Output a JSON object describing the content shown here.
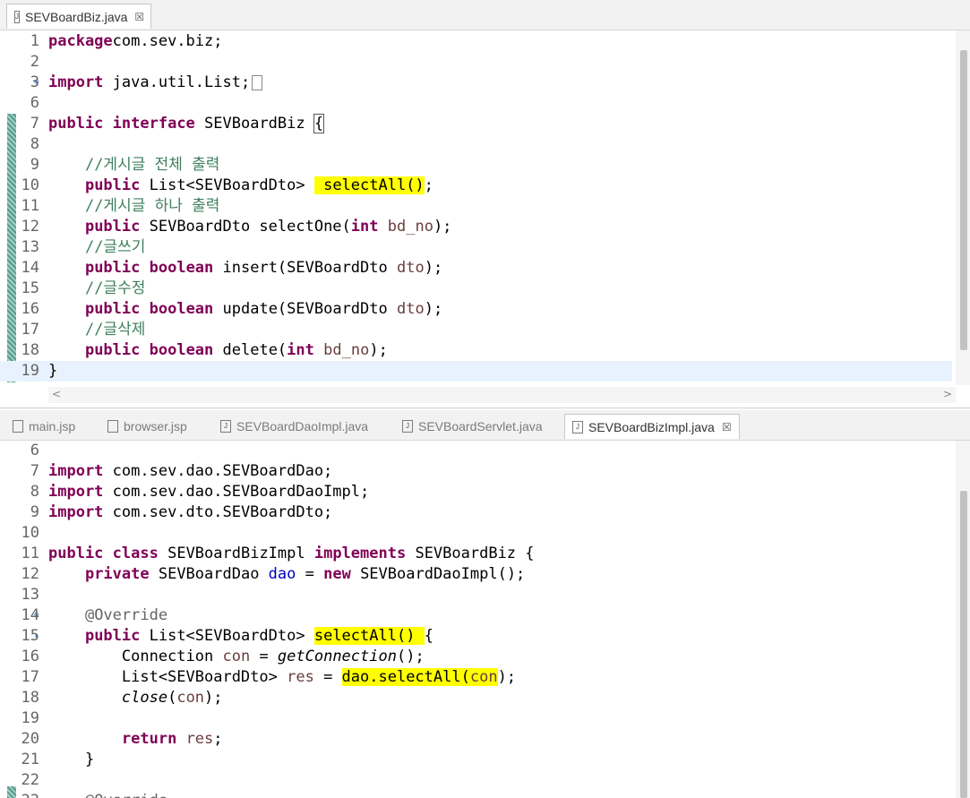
{
  "top_editor": {
    "tab": {
      "label": "SEVBoardBiz.java",
      "close": "☒"
    },
    "lines": [
      {
        "n": "1",
        "mark": "",
        "t": [
          [
            "kw",
            "package"
          ],
          [
            "",
            "com.sev.biz;"
          ]
        ]
      },
      {
        "n": "2",
        "mark": "",
        "t": []
      },
      {
        "n": "3",
        "mark": "⊕",
        "t": [
          [
            "kw",
            "import"
          ],
          [
            "",
            " java.util.List;"
          ]
        ]
      },
      {
        "n": "6",
        "mark": "",
        "t": []
      },
      {
        "n": "7",
        "mark": "",
        "t": [
          [
            "kw",
            "public"
          ],
          [
            "",
            " "
          ],
          [
            "kw",
            "interface"
          ],
          [
            "",
            " SEVBoardBiz "
          ],
          [
            "brace",
            "{"
          ]
        ]
      },
      {
        "n": "8",
        "mark": "",
        "t": []
      },
      {
        "n": "9",
        "mark": "",
        "t": [
          [
            "",
            "    "
          ],
          [
            "cm",
            "//게시글 전체 출력"
          ]
        ]
      },
      {
        "n": "10",
        "mark": "",
        "t": [
          [
            "",
            "    "
          ],
          [
            "kw",
            "public"
          ],
          [
            "",
            " List<SEVBoardDto> "
          ],
          [
            "hl",
            " selectAll()"
          ],
          [
            "",
            ";"
          ]
        ]
      },
      {
        "n": "11",
        "mark": "",
        "t": [
          [
            "",
            "    "
          ],
          [
            "cm",
            "//게시글 하나 출력"
          ]
        ]
      },
      {
        "n": "12",
        "mark": "",
        "t": [
          [
            "",
            "    "
          ],
          [
            "kw",
            "public"
          ],
          [
            "",
            " SEVBoardDto selectOne("
          ],
          [
            "kw",
            "int"
          ],
          [
            "",
            " "
          ],
          [
            "var",
            "bd_no"
          ],
          [
            "",
            ");"
          ]
        ]
      },
      {
        "n": "13",
        "mark": "",
        "t": [
          [
            "",
            "    "
          ],
          [
            "cm",
            "//글쓰기"
          ]
        ]
      },
      {
        "n": "14",
        "mark": "",
        "t": [
          [
            "",
            "    "
          ],
          [
            "kw",
            "public"
          ],
          [
            "",
            " "
          ],
          [
            "kw",
            "boolean"
          ],
          [
            "",
            " insert(SEVBoardDto "
          ],
          [
            "var",
            "dto"
          ],
          [
            "",
            ");"
          ]
        ]
      },
      {
        "n": "15",
        "mark": "",
        "t": [
          [
            "",
            "    "
          ],
          [
            "cm",
            "//글수정"
          ]
        ]
      },
      {
        "n": "16",
        "mark": "",
        "t": [
          [
            "",
            "    "
          ],
          [
            "kw",
            "public"
          ],
          [
            "",
            " "
          ],
          [
            "kw",
            "boolean"
          ],
          [
            "",
            " update(SEVBoardDto "
          ],
          [
            "var",
            "dto"
          ],
          [
            "",
            ");"
          ]
        ]
      },
      {
        "n": "17",
        "mark": "",
        "t": [
          [
            "",
            "    "
          ],
          [
            "cm",
            "//글삭제"
          ]
        ]
      },
      {
        "n": "18",
        "mark": "",
        "t": [
          [
            "",
            "    "
          ],
          [
            "kw",
            "public"
          ],
          [
            "",
            " "
          ],
          [
            "kw",
            "boolean"
          ],
          [
            "",
            " delete("
          ],
          [
            "kw",
            "int"
          ],
          [
            "",
            " "
          ],
          [
            "var",
            "bd_no"
          ],
          [
            "",
            ");"
          ]
        ]
      },
      {
        "n": "19",
        "mark": "",
        "t": [
          [
            "",
            "}"
          ]
        ]
      }
    ],
    "scroll_left": "<",
    "scroll_right": ">"
  },
  "bottom_editor": {
    "tabs": [
      {
        "label": "main.jsp",
        "active": false
      },
      {
        "label": "browser.jsp",
        "active": false
      },
      {
        "label": "SEVBoardDaoImpl.java",
        "active": false
      },
      {
        "label": "SEVBoardServlet.java",
        "active": false
      },
      {
        "label": "SEVBoardBizImpl.java",
        "active": true
      }
    ],
    "close": "☒",
    "lines": [
      {
        "n": "6",
        "mark": "",
        "t": []
      },
      {
        "n": "7",
        "mark": "",
        "t": [
          [
            "kw",
            "import"
          ],
          [
            "",
            " com.sev.dao.SEVBoardDao;"
          ]
        ]
      },
      {
        "n": "8",
        "mark": "",
        "t": [
          [
            "kw",
            "import"
          ],
          [
            "",
            " com.sev.dao.SEVBoardDaoImpl;"
          ]
        ]
      },
      {
        "n": "9",
        "mark": "",
        "t": [
          [
            "kw",
            "import"
          ],
          [
            "",
            " com.sev.dto.SEVBoardDto;"
          ]
        ]
      },
      {
        "n": "10",
        "mark": "",
        "t": []
      },
      {
        "n": "11",
        "mark": "",
        "t": [
          [
            "kw",
            "public"
          ],
          [
            "",
            " "
          ],
          [
            "kw",
            "class"
          ],
          [
            "",
            " SEVBoardBizImpl "
          ],
          [
            "kw",
            "implements"
          ],
          [
            "",
            " SEVBoardBiz {"
          ]
        ]
      },
      {
        "n": "12",
        "mark": "",
        "t": [
          [
            "",
            "    "
          ],
          [
            "kw",
            "private"
          ],
          [
            "",
            " SEVBoardDao "
          ],
          [
            "fld",
            "dao"
          ],
          [
            "",
            " = "
          ],
          [
            "kw",
            "new"
          ],
          [
            "",
            " SEVBoardDaoImpl();"
          ]
        ]
      },
      {
        "n": "13",
        "mark": "",
        "t": []
      },
      {
        "n": "14",
        "mark": "⊖",
        "t": [
          [
            "",
            "    "
          ],
          [
            "an",
            "@Override"
          ]
        ]
      },
      {
        "n": "15",
        "mark": "▴",
        "t": [
          [
            "",
            "    "
          ],
          [
            "kw",
            "public"
          ],
          [
            "",
            " List<SEVBoardDto> "
          ],
          [
            "hl",
            "selectAll() "
          ],
          [
            "",
            "{"
          ]
        ]
      },
      {
        "n": "16",
        "mark": "",
        "t": [
          [
            "",
            "        Connection "
          ],
          [
            "var",
            "con"
          ],
          [
            "",
            " = "
          ],
          [
            "it",
            "getConnection"
          ],
          [
            "",
            "();"
          ]
        ]
      },
      {
        "n": "17",
        "mark": "",
        "t": [
          [
            "",
            "        List<SEVBoardDto> "
          ],
          [
            "var",
            "res"
          ],
          [
            "",
            " = "
          ],
          [
            "hl",
            "dao.selectAll("
          ],
          [
            "hlv",
            "con"
          ],
          [
            "",
            ");"
          ]
        ]
      },
      {
        "n": "18",
        "mark": "",
        "t": [
          [
            "",
            "        "
          ],
          [
            "it",
            "close"
          ],
          [
            "",
            "("
          ],
          [
            "var",
            "con"
          ],
          [
            "",
            ");"
          ]
        ]
      },
      {
        "n": "19",
        "mark": "",
        "t": []
      },
      {
        "n": "20",
        "mark": "",
        "t": [
          [
            "",
            "        "
          ],
          [
            "kw",
            "return"
          ],
          [
            "",
            " "
          ],
          [
            "var",
            "res"
          ],
          [
            "",
            ";"
          ]
        ]
      },
      {
        "n": "21",
        "mark": "",
        "t": [
          [
            "",
            "    }"
          ]
        ]
      },
      {
        "n": "22",
        "mark": "",
        "t": []
      },
      {
        "n": "23",
        "mark": "",
        "t": [
          [
            "",
            "    "
          ],
          [
            "an",
            "@Override"
          ]
        ]
      }
    ]
  }
}
